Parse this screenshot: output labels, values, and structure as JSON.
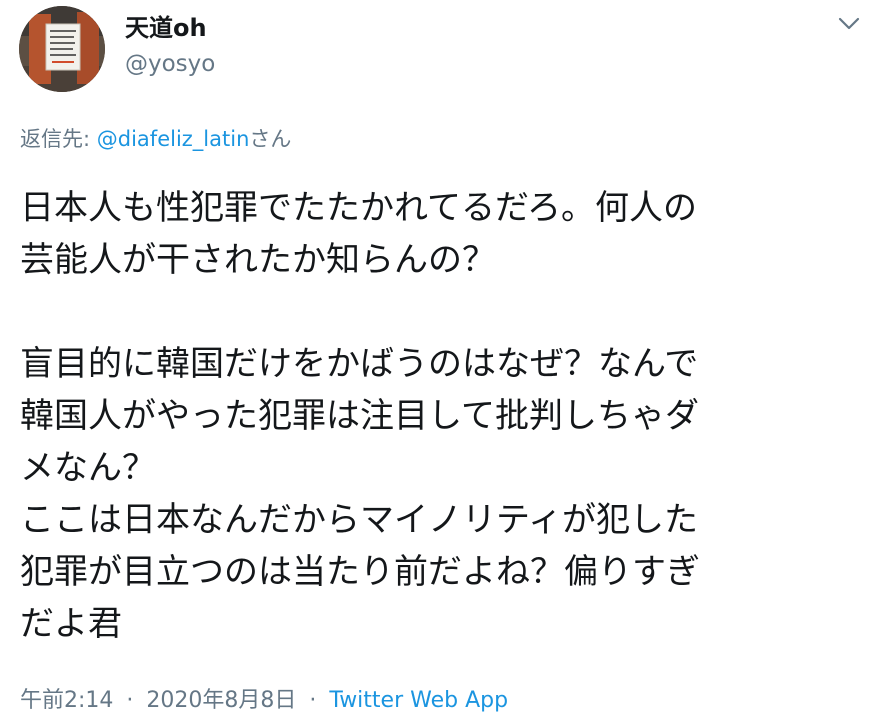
{
  "author": {
    "display_name": "天道oh",
    "handle": "@yosyo",
    "avatar_icon": "profile-photo-icon"
  },
  "reply": {
    "prefix": "返信先: ",
    "mention": "@diafeliz_latin",
    "suffix": "さん"
  },
  "tweet": {
    "lines": [
      "日本人も性犯罪でたたかれてるだろ。何人の",
      "芸能人が干されたか知らんの？",
      "",
      "盲目的に韓国だけをかばうのはなぜ？なんで",
      "韓国人がやった犯罪は注目して批判しちゃダ",
      "メなん？",
      "ここは日本なんだからマイノリティが犯した",
      "犯罪が目立つのは当たり前だよね？偏りすぎ",
      "だよ君"
    ]
  },
  "meta": {
    "time": "午前2:14",
    "separator": "·",
    "date": "2020年8月8日",
    "source": "Twitter Web App"
  },
  "colors": {
    "text": "#14171a",
    "secondary": "#657786",
    "link": "#1b95e0"
  }
}
